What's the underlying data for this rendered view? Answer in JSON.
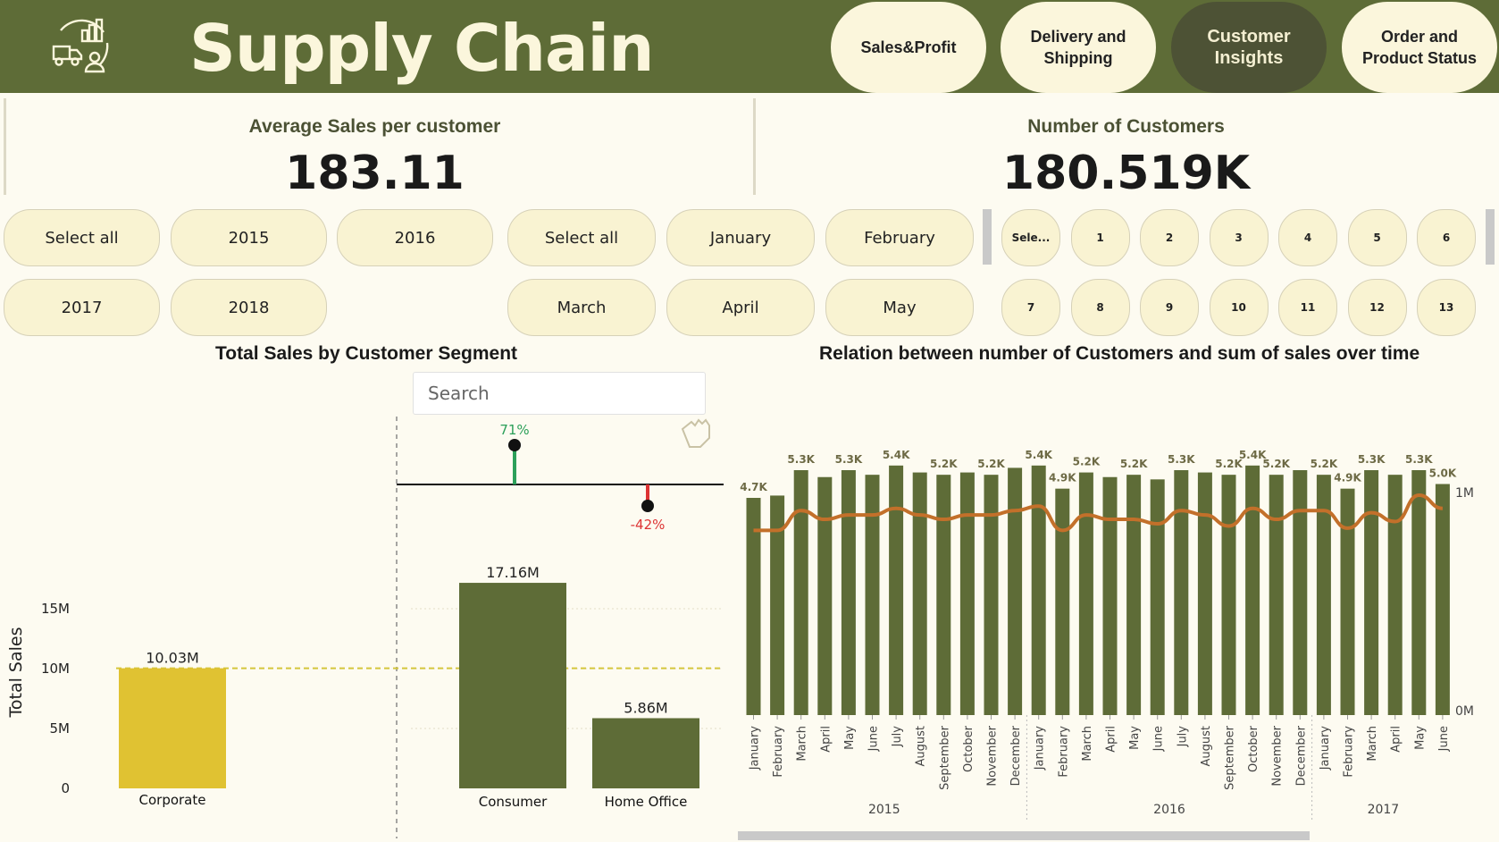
{
  "header": {
    "title": "Supply Chain",
    "nav": [
      {
        "label": "Sales&Profit",
        "active": false
      },
      {
        "label": "Delivery and\nShipping",
        "active": false
      },
      {
        "label": "Customer\nInsights",
        "active": true
      },
      {
        "label": "Order and\nProduct Status",
        "active": false
      }
    ]
  },
  "kpis": {
    "avg_sales": {
      "title": "Average Sales per customer",
      "value": "183.11"
    },
    "num_customers": {
      "title": "Number of Customers",
      "value": "180.519K"
    }
  },
  "slicers": {
    "years": [
      "Select all",
      "2015",
      "2016",
      "2017",
      "2018"
    ],
    "months": [
      "Select all",
      "January",
      "February",
      "March",
      "April",
      "May"
    ],
    "days": [
      "Sele...",
      "1",
      "2",
      "3",
      "4",
      "5",
      "6",
      "7",
      "8",
      "9",
      "10",
      "11",
      "12",
      "13"
    ]
  },
  "segment_chart": {
    "title": "Total Sales by Customer Segment",
    "search_placeholder": "Search",
    "y_label": "Total Sales",
    "y_ticks": [
      "0",
      "5M",
      "10M",
      "15M"
    ],
    "pct_up": "71%",
    "pct_down": "-42%"
  },
  "time_chart": {
    "title": "Relation between number of Customers and sum of sales over time",
    "right_ticks": [
      "0M",
      "1M"
    ],
    "years": [
      "2015",
      "2016",
      "2017"
    ]
  },
  "colors": {
    "header": "#5e6c37",
    "bar_green": "#5e6c37",
    "bar_yellow": "#e0c232",
    "line_orange": "#c3702a"
  },
  "chart_data": [
    {
      "type": "bar",
      "title": "Total Sales by Customer Segment",
      "ylabel": "Total Sales",
      "categories": [
        "Corporate",
        "Consumer",
        "Home Office"
      ],
      "values": [
        10.03,
        17.16,
        5.86
      ],
      "value_labels": [
        "10.03M",
        "17.16M",
        "5.86M"
      ],
      "units": "M",
      "ylim": [
        0,
        20
      ],
      "reference_line": 10.03,
      "variance": [
        {
          "category": "Consumer",
          "label": "71%"
        },
        {
          "category": "Home Office",
          "label": "-42%"
        }
      ]
    },
    {
      "type": "bar",
      "title": "Relation between number of Customers and sum of sales over time",
      "categories": [
        "January",
        "February",
        "March",
        "April",
        "May",
        "June",
        "July",
        "August",
        "September",
        "October",
        "November",
        "December",
        "January",
        "February",
        "March",
        "April",
        "May",
        "June",
        "July",
        "August",
        "September",
        "October",
        "November",
        "December",
        "January",
        "February",
        "March",
        "April",
        "May",
        "June"
      ],
      "years": [
        {
          "label": "2015",
          "count": 12
        },
        {
          "label": "2016",
          "count": 12
        },
        {
          "label": "2017",
          "count": 6
        }
      ],
      "series": [
        {
          "values": [
            4.7,
            4.75,
            5.3,
            5.15,
            5.3,
            5.2,
            5.4,
            5.25,
            5.2,
            5.25,
            5.2,
            5.35,
            5.4,
            4.9,
            5.25,
            5.15,
            5.2,
            5.1,
            5.3,
            5.25,
            5.2,
            5.4,
            5.2,
            5.3,
            5.2,
            4.9,
            5.3,
            5.2,
            5.3,
            5.0
          ],
          "value_labels": [
            "4.7K",
            "",
            "5.3K",
            "",
            "5.3K",
            "",
            "5.4K",
            "",
            "5.2K",
            "",
            "5.2K",
            "",
            "5.4K",
            "4.9K",
            "5.2K",
            "",
            "5.2K",
            "",
            "5.3K",
            "",
            "5.2K",
            "5.4K",
            "5.2K",
            "",
            "5.2K",
            "4.9K",
            "5.3K",
            "",
            "5.3K",
            "5.0K"
          ]
        },
        {
          "values": [
            0.84,
            0.84,
            0.93,
            0.89,
            0.91,
            0.91,
            0.94,
            0.91,
            0.89,
            0.91,
            0.91,
            0.93,
            0.95,
            0.84,
            0.91,
            0.89,
            0.89,
            0.87,
            0.93,
            0.91,
            0.86,
            0.94,
            0.89,
            0.93,
            0.93,
            0.85,
            0.92,
            0.88,
            1.0,
            0.94
          ]
        }
      ],
      "ylim": [
        0,
        6
      ],
      "y2lim": [
        0,
        1.5
      ]
    }
  ]
}
